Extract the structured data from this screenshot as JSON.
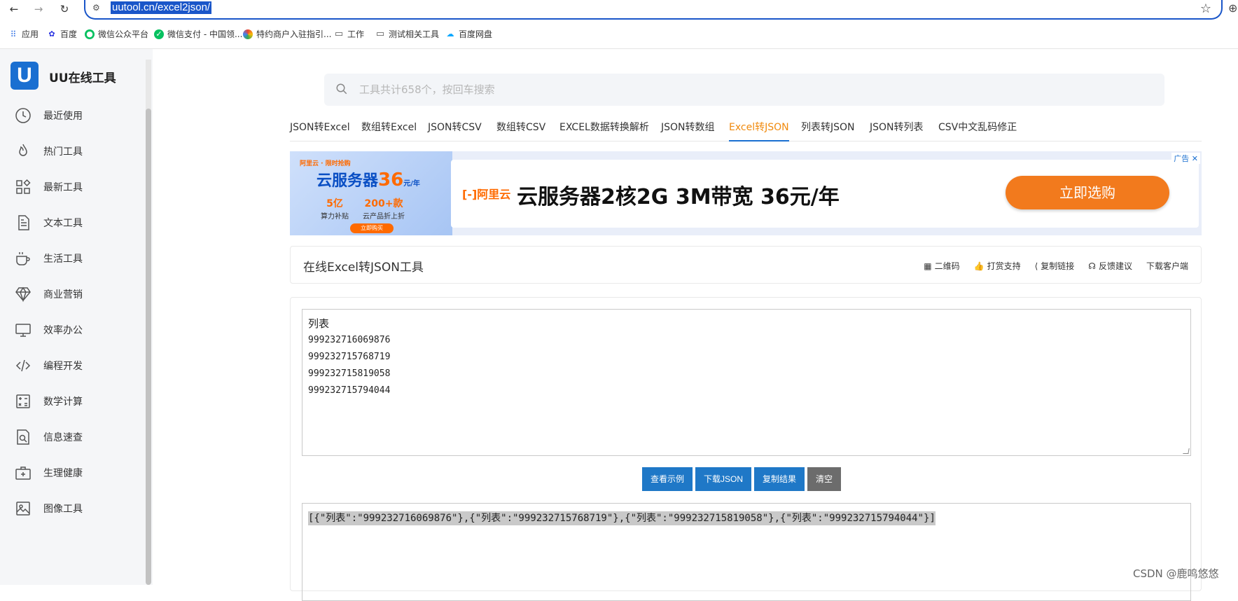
{
  "browser": {
    "url": "uutool.cn/excel2json/"
  },
  "bookmarks": [
    {
      "label": "应用",
      "color": "#3b78e7"
    },
    {
      "label": "百度",
      "color": "#2932e1"
    },
    {
      "label": "微信公众平台",
      "color": "#07c160"
    },
    {
      "label": "微信支付 - 中国领...",
      "color": "#07c160"
    },
    {
      "label": "特约商户入驻指引...",
      "color": "#8a4fd8"
    },
    {
      "label": "工作",
      "color": "#555555"
    },
    {
      "label": "测试相关工具",
      "color": "#555555"
    },
    {
      "label": "百度网盘",
      "color": "#06a7ff"
    }
  ],
  "sidebar": {
    "logo_letter": "U",
    "logo_text": "UU在线工具",
    "items": [
      {
        "label": "最近使用"
      },
      {
        "label": "热门工具"
      },
      {
        "label": "最新工具"
      },
      {
        "label": "文本工具"
      },
      {
        "label": "生活工具"
      },
      {
        "label": "商业营销"
      },
      {
        "label": "效率办公"
      },
      {
        "label": "编程开发"
      },
      {
        "label": "数学计算"
      },
      {
        "label": "信息速查"
      },
      {
        "label": "生理健康"
      },
      {
        "label": "图像工具"
      }
    ]
  },
  "search": {
    "placeholder": "工具共计658个，按回车搜索"
  },
  "tabs": [
    {
      "label": "JSON转Excel"
    },
    {
      "label": "数组转Excel"
    },
    {
      "label": "JSON转CSV"
    },
    {
      "label": "数组转CSV"
    },
    {
      "label": "EXCEL数据转换解析"
    },
    {
      "label": "JSON转数组"
    },
    {
      "label": "Excel转JSON"
    },
    {
      "label": "列表转JSON"
    },
    {
      "label": "JSON转列表"
    },
    {
      "label": "CSV中文乱码修正"
    }
  ],
  "ad": {
    "left_brand": "阿里云 · 限时抢购",
    "left_title_prefix": "云服务器",
    "left_title_price": "36",
    "left_title_suffix": "元/年",
    "left_stat1_value": "5亿",
    "left_stat1_label": "算力补贴",
    "left_stat2_value": "200+款",
    "left_stat2_label": "云产品折上折",
    "left_button": "立即购买",
    "brand": "[-]阿里云",
    "title": "云服务器2核2G 3M带宽 36元/年",
    "cta": "立即选购",
    "badge": "广告 ✕"
  },
  "tool": {
    "title": "在线Excel转JSON工具",
    "actions": [
      {
        "label": "二维码"
      },
      {
        "label": "打赏支持"
      },
      {
        "label": "复制链接"
      },
      {
        "label": "反馈建议"
      },
      {
        "label": "下载客户端"
      }
    ]
  },
  "input": {
    "header": "列表",
    "lines": [
      "999232716069876",
      "999232715768719",
      "999232715819058",
      "999232715794044"
    ]
  },
  "buttons": {
    "example": "查看示例",
    "download": "下载JSON",
    "copy": "复制结果",
    "clear": "清空"
  },
  "output": {
    "text": "[{\"列表\":\"999232716069876\"},{\"列表\":\"999232715768719\"},{\"列表\":\"999232715819058\"},{\"列表\":\"999232715794044\"}]"
  },
  "watermark": "CSDN @鹿鸣悠悠",
  "colors": {
    "accent": "#1f78c7",
    "active_tab": "#f08a0d",
    "url_highlight": "#1a56c9"
  }
}
